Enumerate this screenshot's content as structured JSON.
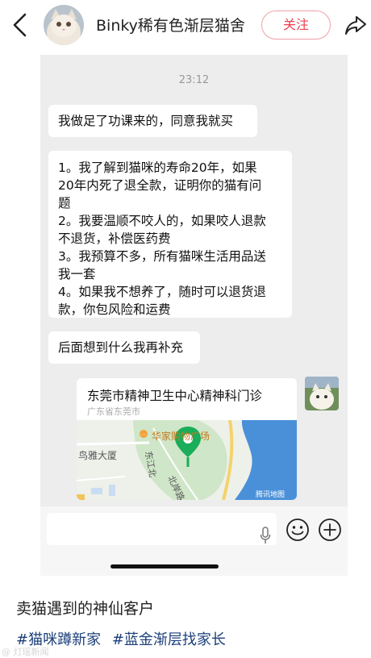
{
  "header": {
    "account_name": "Binky稀有色渐层猫舍",
    "follow_label": "关注",
    "icons": {
      "back": "chevron-left-icon",
      "share": "share-arrow-icon",
      "avatar": "cat-avatar"
    }
  },
  "chat": {
    "timestamp": "23:12",
    "messages": [
      {
        "side": "left",
        "text": "我做足了功课来的，同意我就买"
      },
      {
        "side": "left",
        "text": "1。我了解到猫咪的寿命20年，如果\n20年内死了退全款，证明你的猫有问\n题\n2。我要温顺不咬人的，如果咬人退款\n不退货，补偿医药费\n3。我预算不多，所有猫咪生活用品送\n我一套\n4。如果我不想养了，随时可以退货退\n款，你包风险和运费"
      },
      {
        "side": "left",
        "text": "后面想到什么我再补充"
      }
    ],
    "location": {
      "title": "东莞市精神卫生中心精神科门诊",
      "subtitle": "广东省东莞市",
      "map_labels": {
        "poi": "华家购物广场",
        "building": "鸟雅大厦",
        "road": "东江北",
        "road_2": "北岸路",
        "provider": "腾讯地图"
      }
    },
    "input": {
      "placeholder": "",
      "icons": {
        "mic": "microphone-icon",
        "emoji": "emoji-icon",
        "plus": "plus-icon"
      }
    }
  },
  "caption": {
    "title": "卖猫遇到的神仙客户",
    "tags": [
      "#猫咪蹲新家",
      "#蓝金渐层找家长"
    ],
    "watermark": "@ 灯瑶新闻"
  },
  "colors": {
    "follow_accent": "#f03e52",
    "chat_background": "#ededed",
    "tag_color": "#1c3f7a",
    "map_water": "#4a90d9",
    "map_pin": "#1aad5a"
  }
}
